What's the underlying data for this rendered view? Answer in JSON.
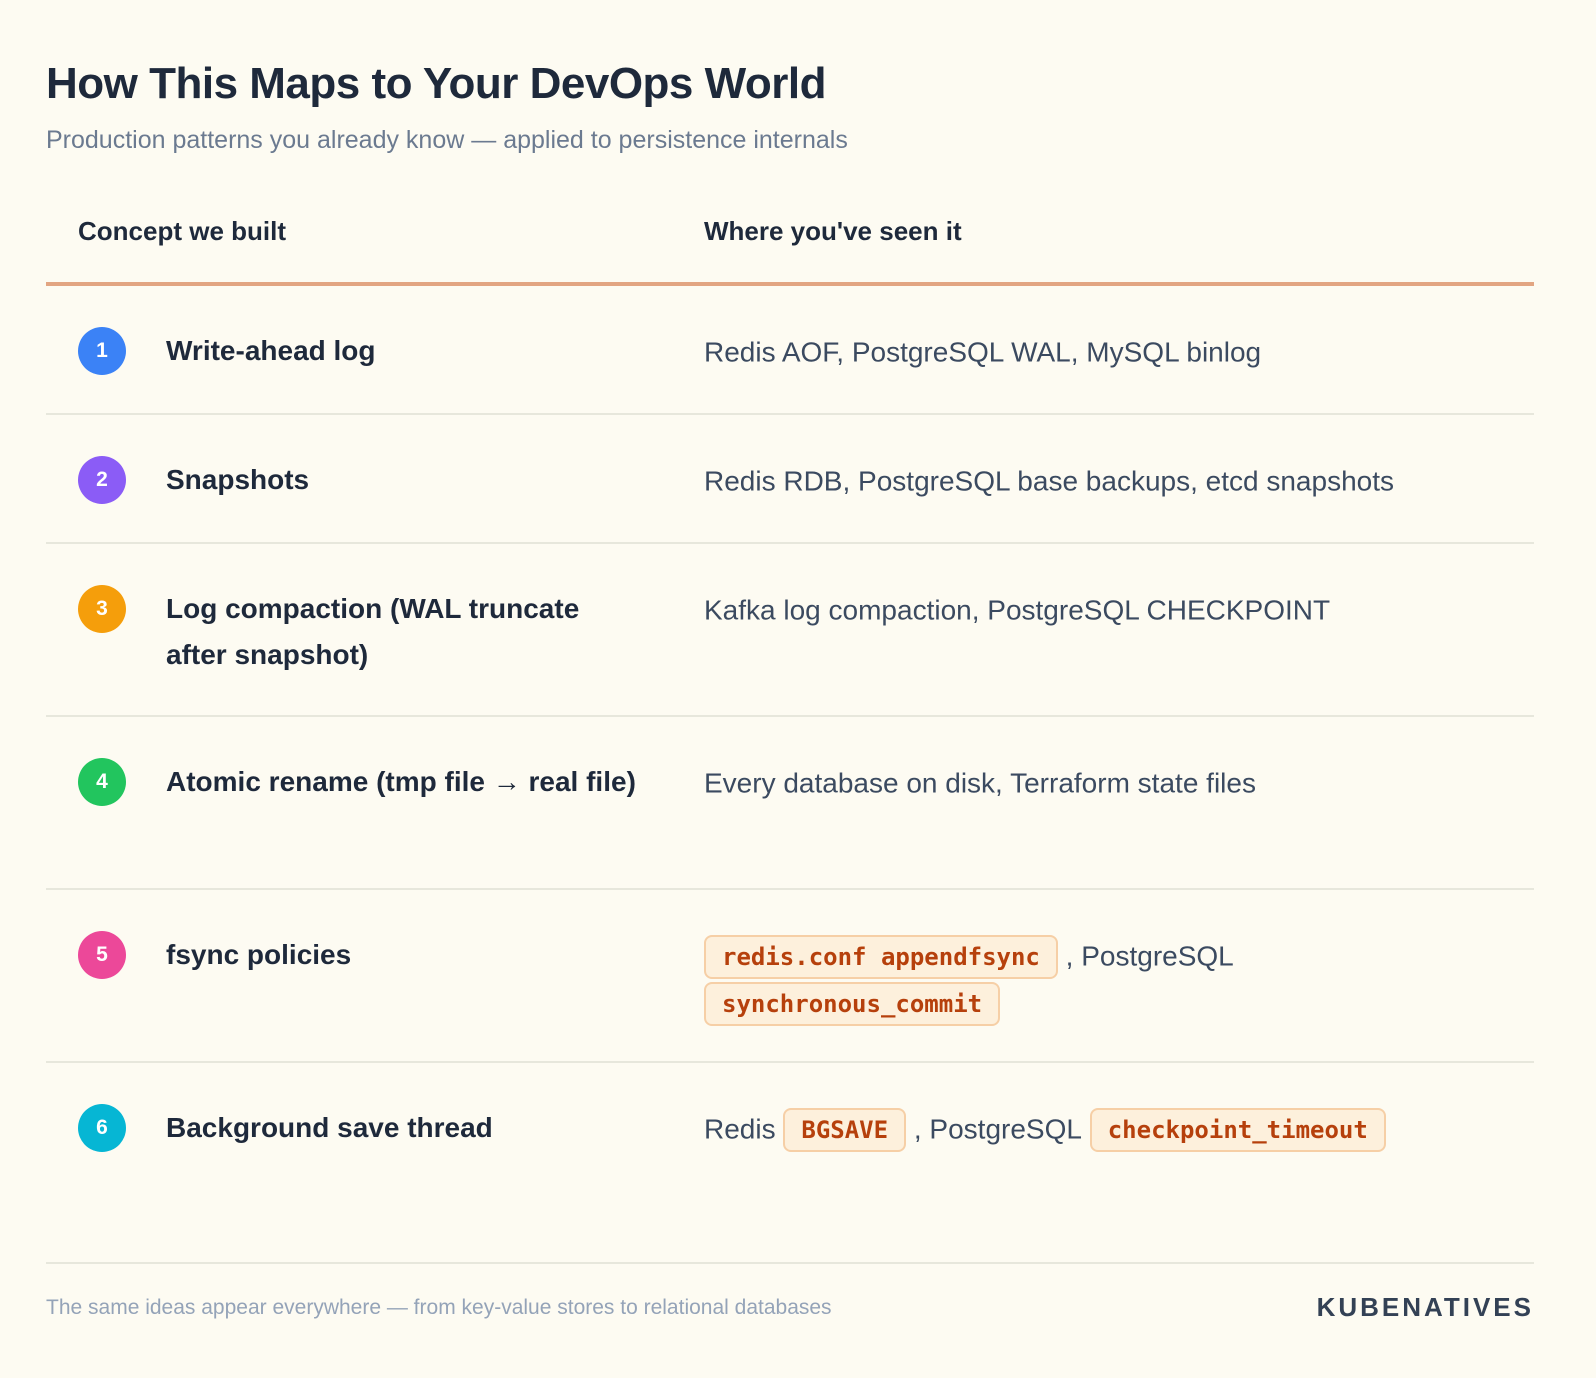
{
  "header": {
    "title": "How This Maps to Your DevOps World",
    "subtitle": "Production patterns you already know — applied to persistence internals"
  },
  "table": {
    "columns": [
      "Concept we built",
      "Where you've seen it"
    ],
    "rows": [
      {
        "num": "1",
        "color": "#3b82f6",
        "concept": "Write-ahead log",
        "where": [
          {
            "text": "Redis AOF, PostgreSQL WAL, MySQL binlog"
          }
        ]
      },
      {
        "num": "2",
        "color": "#8b5cf6",
        "concept": "Snapshots",
        "where": [
          {
            "text": "Redis RDB, PostgreSQL base backups, etcd snapshots"
          }
        ]
      },
      {
        "num": "3",
        "color": "#f59e0b",
        "concept": "Log compaction (WAL truncate after snapshot)",
        "where": [
          {
            "text": "Kafka log compaction, PostgreSQL CHECKPOINT"
          }
        ]
      },
      {
        "num": "4",
        "color": "#22c55e",
        "concept": "Atomic rename (tmp file → real file)",
        "where": [
          {
            "text": "Every database on disk, Terraform state files"
          }
        ]
      },
      {
        "num": "5",
        "color": "#ec4899",
        "concept": "fsync policies",
        "where": [
          {
            "code": "redis.conf appendfsync"
          },
          {
            "text": ", PostgreSQL"
          },
          {
            "code": "synchronous_commit"
          }
        ]
      },
      {
        "num": "6",
        "color": "#06b6d4",
        "concept": "Background save thread",
        "where": [
          {
            "text": "Redis"
          },
          {
            "code": "BGSAVE"
          },
          {
            "text": ", PostgreSQL"
          },
          {
            "code": "checkpoint_timeout"
          }
        ]
      }
    ]
  },
  "footer": {
    "note": "The same ideas appear everywhere — from key-value stores to relational databases",
    "brand": "KUBENATIVES"
  }
}
